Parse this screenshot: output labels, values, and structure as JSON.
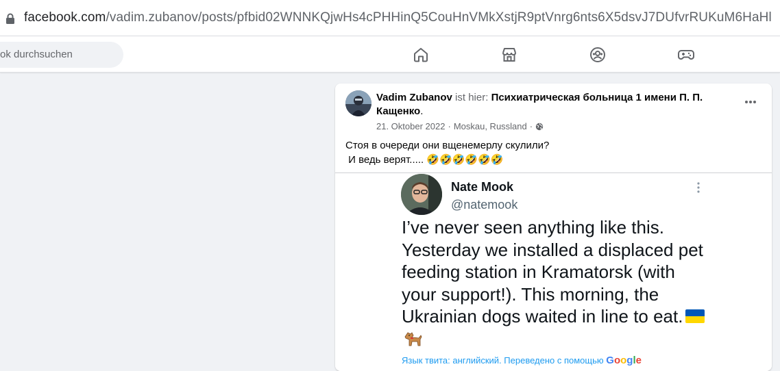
{
  "browser": {
    "url_domain": "facebook.com",
    "url_path": "/vadim.zubanov/posts/pfbid02WNNKQjwHs4cPHHinQ5CouHnVMkXstjR9ptVnrg6nts6X5dsvJ7DUfvrRUKuM6HaHl"
  },
  "nav": {
    "search_placeholder": "ok durchsuchen",
    "icons": [
      "home-icon",
      "marketplace-icon",
      "groups-icon",
      "gaming-icon"
    ]
  },
  "post": {
    "author": "Vadim Zubanov",
    "is_here": "ist hier:",
    "place": "Психиатрическая больница 1 имени П. П. Кащенко",
    "place_suffix": ".",
    "date": "21. Oktober 2022",
    "separator": "·",
    "location": "Moskau, Russland",
    "separator2": "·",
    "text_line1": "Стоя в очереди они вщенемерлу скулили?",
    "text_line2": " И ведь верят..... 🤣🤣🤣🤣🤣🤣"
  },
  "tweet": {
    "name": "Nate Mook",
    "handle": "@natemook",
    "body": "I’ve never seen anything like this. Yesterday we installed a displaced pet feeding station in Kramatorsk (with your support!). This morning, the Ukrainian dogs waited in line to eat.",
    "translate_text": "Язык твита: английский. Переведено с помощью",
    "translate_brand": "Google"
  },
  "colors": {
    "facebook_blue": "#1877f2",
    "tweet_link": "#1d9bf0",
    "flag_blue": "#0057b7",
    "flag_yellow": "#ffd700"
  }
}
